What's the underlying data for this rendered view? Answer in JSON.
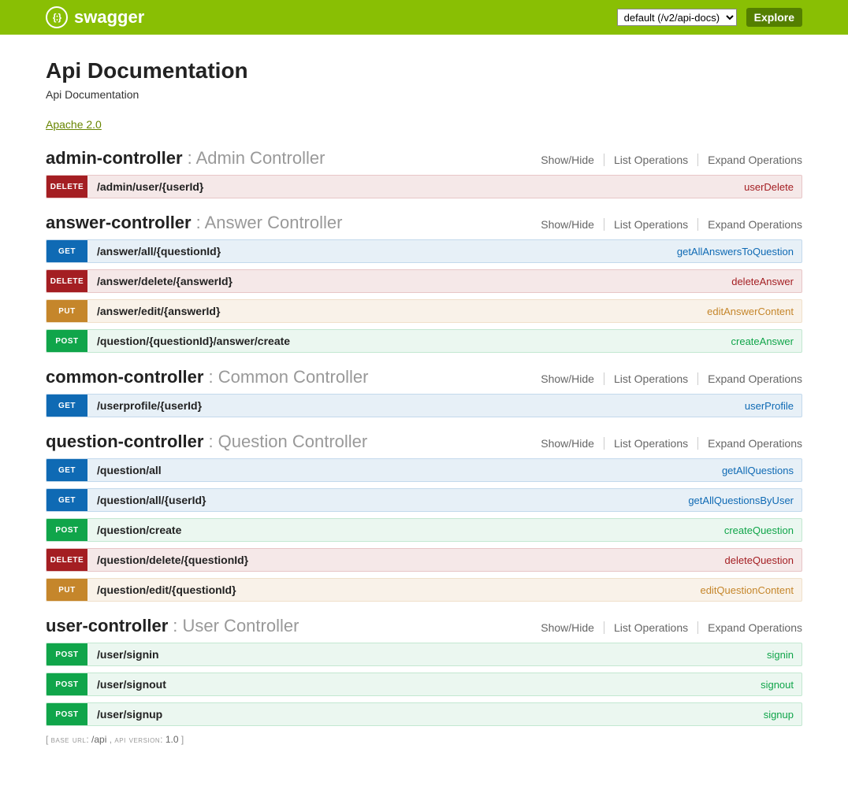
{
  "header": {
    "logo_text": "swagger",
    "logo_glyph": "{:}",
    "api_select_value": "default (/v2/api-docs)",
    "explore_label": "Explore"
  },
  "info": {
    "title": "Api Documentation",
    "subtitle": "Api Documentation",
    "license_label": "Apache 2.0"
  },
  "links": {
    "show_hide": "Show/Hide",
    "list_ops": "List Operations",
    "expand_ops": "Expand Operations"
  },
  "controllers": [
    {
      "name": "admin-controller",
      "desc": "Admin Controller",
      "ops": [
        {
          "method": "delete",
          "path": "/admin/user/{userId}",
          "summary": "userDelete"
        }
      ]
    },
    {
      "name": "answer-controller",
      "desc": "Answer Controller",
      "ops": [
        {
          "method": "get",
          "path": "/answer/all/{questionId}",
          "summary": "getAllAnswersToQuestion"
        },
        {
          "method": "delete",
          "path": "/answer/delete/{answerId}",
          "summary": "deleteAnswer"
        },
        {
          "method": "put",
          "path": "/answer/edit/{answerId}",
          "summary": "editAnswerContent"
        },
        {
          "method": "post",
          "path": "/question/{questionId}/answer/create",
          "summary": "createAnswer"
        }
      ]
    },
    {
      "name": "common-controller",
      "desc": "Common Controller",
      "ops": [
        {
          "method": "get",
          "path": "/userprofile/{userId}",
          "summary": "userProfile"
        }
      ]
    },
    {
      "name": "question-controller",
      "desc": "Question Controller",
      "ops": [
        {
          "method": "get",
          "path": "/question/all",
          "summary": "getAllQuestions"
        },
        {
          "method": "get",
          "path": "/question/all/{userId}",
          "summary": "getAllQuestionsByUser"
        },
        {
          "method": "post",
          "path": "/question/create",
          "summary": "createQuestion"
        },
        {
          "method": "delete",
          "path": "/question/delete/{questionId}",
          "summary": "deleteQuestion"
        },
        {
          "method": "put",
          "path": "/question/edit/{questionId}",
          "summary": "editQuestionContent"
        }
      ]
    },
    {
      "name": "user-controller",
      "desc": "User Controller",
      "ops": [
        {
          "method": "post",
          "path": "/user/signin",
          "summary": "signin"
        },
        {
          "method": "post",
          "path": "/user/signout",
          "summary": "signout"
        },
        {
          "method": "post",
          "path": "/user/signup",
          "summary": "signup"
        }
      ]
    }
  ],
  "footer": {
    "base_url_label": "base url",
    "base_url": "/api",
    "api_version_label": "api version",
    "api_version": "1.0"
  }
}
